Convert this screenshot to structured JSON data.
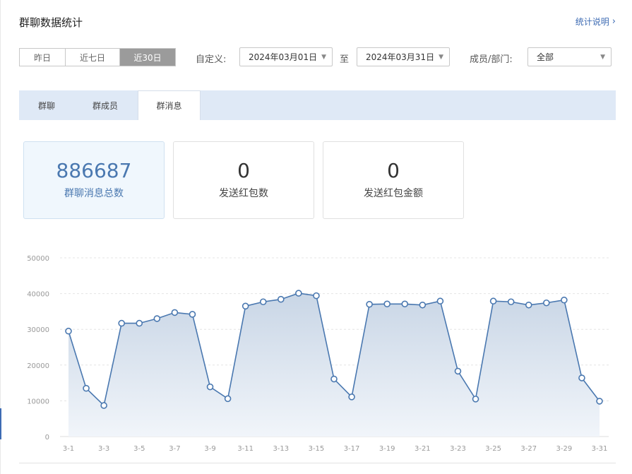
{
  "header": {
    "title": "群聊数据统计",
    "help_link": "统计说明"
  },
  "filters": {
    "quick_ranges": [
      "昨日",
      "近七日",
      "近30日"
    ],
    "active_range": "近30日",
    "custom_label": "自定义:",
    "start_date": "2024年03月01日",
    "to_label": "至",
    "end_date": "2024年03月31日",
    "member_label": "成员/部门:",
    "member_value": "全部"
  },
  "tabs": {
    "items": [
      "群聊",
      "群成员",
      "群消息"
    ],
    "active": "群消息"
  },
  "stats": [
    {
      "value": "886687",
      "label": "群聊消息总数"
    },
    {
      "value": "0",
      "label": "发送红包数"
    },
    {
      "value": "0",
      "label": "发送红包金额"
    }
  ],
  "colors": {
    "accent": "#3d6bb3",
    "line": "#4a78b0",
    "area_top": "#c9d6e6",
    "area_bottom": "#f1f5fa",
    "tab_bar": "#dfe9f6"
  },
  "icons": {
    "help_chevron": "chevron-right-icon",
    "dropdown_arrow": "triangle-down-icon"
  },
  "chart_data": {
    "type": "area",
    "x": [
      "3-1",
      "3-2",
      "3-3",
      "3-4",
      "3-5",
      "3-6",
      "3-7",
      "3-8",
      "3-9",
      "3-10",
      "3-11",
      "3-12",
      "3-13",
      "3-14",
      "3-15",
      "3-16",
      "3-17",
      "3-18",
      "3-19",
      "3-20",
      "3-21",
      "3-22",
      "3-23",
      "3-24",
      "3-25",
      "3-26",
      "3-27",
      "3-28",
      "3-29",
      "3-30",
      "3-31"
    ],
    "x_tick_labels": [
      "3-1",
      "3-3",
      "3-5",
      "3-7",
      "3-9",
      "3-11",
      "3-13",
      "3-15",
      "3-17",
      "3-19",
      "3-21",
      "3-23",
      "3-25",
      "3-27",
      "3-29",
      "3-31"
    ],
    "values": [
      29500,
      13500,
      8700,
      31700,
      31700,
      33000,
      34700,
      34200,
      13900,
      10600,
      36500,
      37700,
      38400,
      40100,
      39400,
      16100,
      11100,
      37000,
      37100,
      37100,
      36800,
      37900,
      18300,
      10500,
      37900,
      37700,
      36800,
      37400,
      38200,
      16400,
      9900
    ],
    "ylim": [
      0,
      50000
    ],
    "y_ticks": [
      "0",
      "10000",
      "20000",
      "30000",
      "40000",
      "50000"
    ],
    "grid": true
  }
}
